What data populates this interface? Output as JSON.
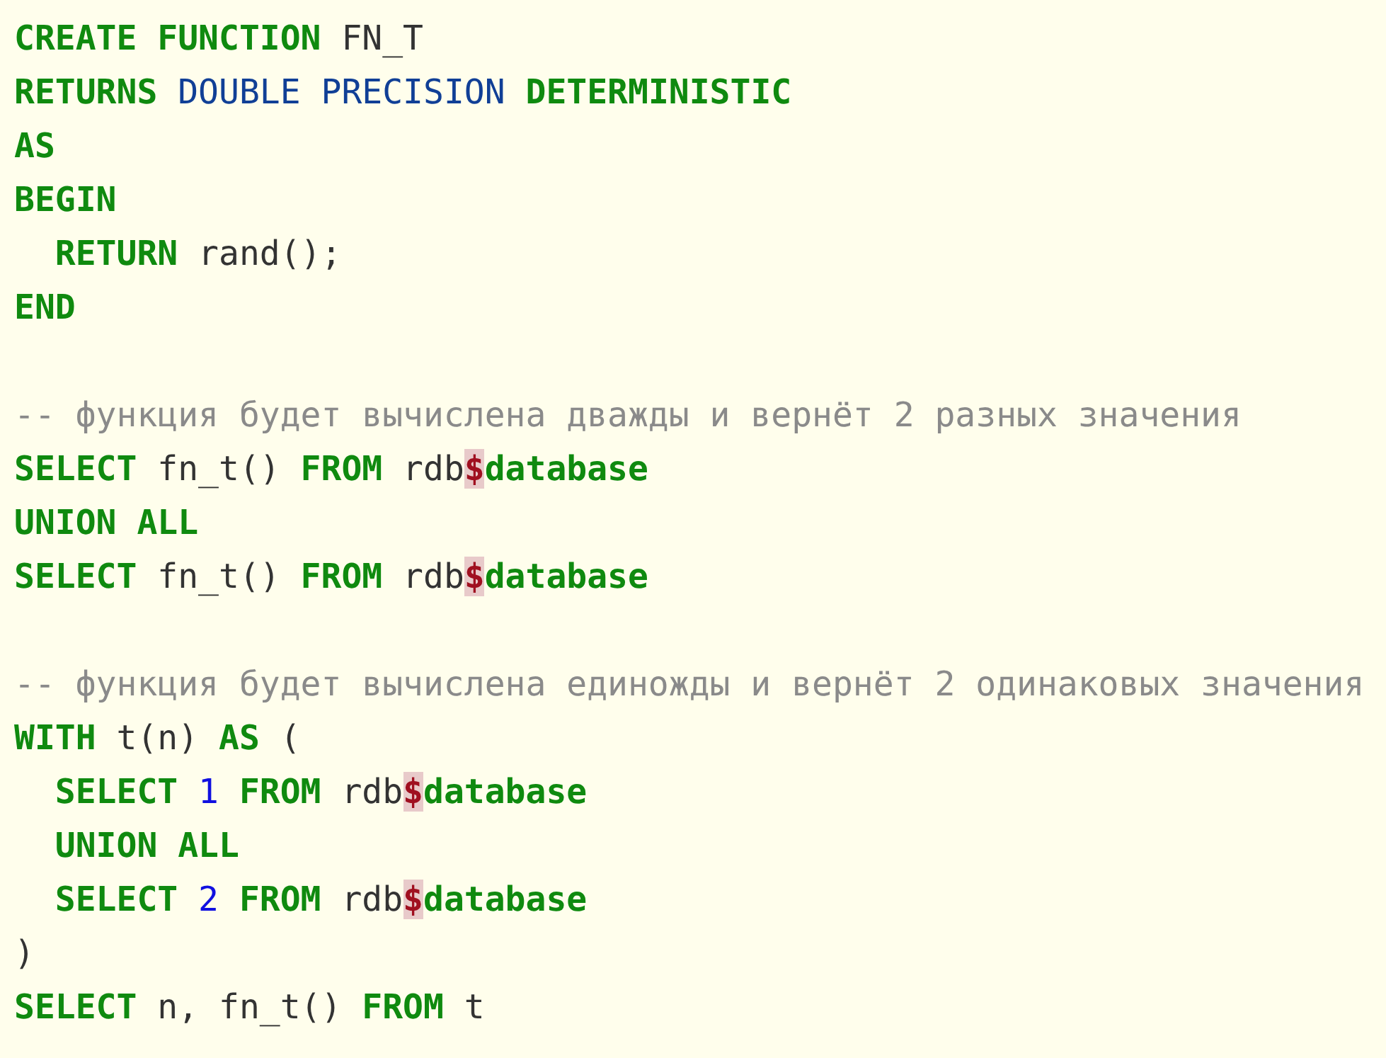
{
  "code_lines": [
    {
      "kind": "code",
      "tokens": [
        {
          "kind": "keyword",
          "text": "CREATE FUNCTION"
        },
        {
          "kind": "plain",
          "text": " FN_T"
        }
      ]
    },
    {
      "kind": "code",
      "tokens": [
        {
          "kind": "keyword",
          "text": "RETURNS"
        },
        {
          "kind": "type",
          "text": " DOUBLE PRECISION"
        },
        {
          "kind": "keyword",
          "text": " DETERMINISTIC"
        }
      ]
    },
    {
      "kind": "code",
      "tokens": [
        {
          "kind": "keyword",
          "text": "AS"
        }
      ]
    },
    {
      "kind": "code",
      "tokens": [
        {
          "kind": "keyword",
          "text": "BEGIN"
        }
      ]
    },
    {
      "kind": "code",
      "tokens": [
        {
          "kind": "keyword",
          "text": "  RETURN"
        },
        {
          "kind": "plain",
          "text": " rand();"
        }
      ]
    },
    {
      "kind": "code",
      "tokens": [
        {
          "kind": "keyword",
          "text": "END"
        }
      ]
    },
    {
      "kind": "blank"
    },
    {
      "kind": "code",
      "tokens": [
        {
          "kind": "comment",
          "text": "-- функция будет вычислена дважды и вернёт 2 разных значения"
        }
      ]
    },
    {
      "kind": "code",
      "tokens": [
        {
          "kind": "keyword",
          "text": "SELECT"
        },
        {
          "kind": "plain",
          "text": " fn_t() "
        },
        {
          "kind": "keyword",
          "text": "FROM"
        },
        {
          "kind": "plain",
          "text": " rdb"
        },
        {
          "kind": "error",
          "text": "$"
        },
        {
          "kind": "keyword",
          "text": "database"
        }
      ]
    },
    {
      "kind": "code",
      "tokens": [
        {
          "kind": "keyword",
          "text": "UNION ALL"
        }
      ]
    },
    {
      "kind": "code",
      "tokens": [
        {
          "kind": "keyword",
          "text": "SELECT"
        },
        {
          "kind": "plain",
          "text": " fn_t() "
        },
        {
          "kind": "keyword",
          "text": "FROM"
        },
        {
          "kind": "plain",
          "text": " rdb"
        },
        {
          "kind": "error",
          "text": "$"
        },
        {
          "kind": "keyword",
          "text": "database"
        }
      ]
    },
    {
      "kind": "blank"
    },
    {
      "kind": "code",
      "tokens": [
        {
          "kind": "comment",
          "text": "-- функция будет вычислена единожды и вернёт 2 одинаковых значения"
        }
      ]
    },
    {
      "kind": "code",
      "tokens": [
        {
          "kind": "keyword",
          "text": "WITH"
        },
        {
          "kind": "plain",
          "text": " t(n) "
        },
        {
          "kind": "keyword",
          "text": "AS"
        },
        {
          "kind": "plain",
          "text": " ("
        }
      ]
    },
    {
      "kind": "code",
      "tokens": [
        {
          "kind": "keyword",
          "text": "  SELECT"
        },
        {
          "kind": "number",
          "text": " 1"
        },
        {
          "kind": "keyword",
          "text": " FROM"
        },
        {
          "kind": "plain",
          "text": " rdb"
        },
        {
          "kind": "error",
          "text": "$"
        },
        {
          "kind": "keyword",
          "text": "database"
        }
      ]
    },
    {
      "kind": "code",
      "tokens": [
        {
          "kind": "keyword",
          "text": "  UNION ALL"
        }
      ]
    },
    {
      "kind": "code",
      "tokens": [
        {
          "kind": "keyword",
          "text": "  SELECT"
        },
        {
          "kind": "number",
          "text": " 2"
        },
        {
          "kind": "keyword",
          "text": " FROM"
        },
        {
          "kind": "plain",
          "text": " rdb"
        },
        {
          "kind": "error",
          "text": "$"
        },
        {
          "kind": "keyword",
          "text": "database"
        }
      ]
    },
    {
      "kind": "code",
      "tokens": [
        {
          "kind": "plain",
          "text": ")"
        }
      ]
    },
    {
      "kind": "code",
      "tokens": [
        {
          "kind": "keyword",
          "text": "SELECT"
        },
        {
          "kind": "plain",
          "text": " n, fn_t() "
        },
        {
          "kind": "keyword",
          "text": "FROM"
        },
        {
          "kind": "plain",
          "text": " t"
        }
      ]
    }
  ]
}
